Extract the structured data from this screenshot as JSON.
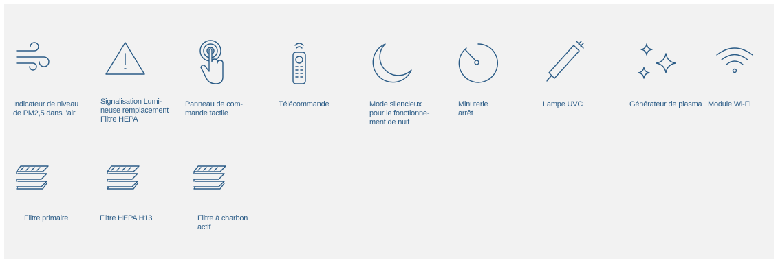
{
  "features": [
    {
      "icon": "wind-icon",
      "label": "Indicateur de niveau\nde PM2,5 dans l’air"
    },
    {
      "icon": "warning-triangle-icon",
      "label": "Signalisation Lumi-\nneuse remplacement\nFiltre  HEPA"
    },
    {
      "icon": "touch-hand-icon",
      "label": "Panneau de com-\nmande tactile"
    },
    {
      "icon": "remote-control-icon",
      "label": "Télécommande"
    },
    {
      "icon": "moon-icon",
      "label": "Mode silencieux\npour le fonctionne-\nment de nuit"
    },
    {
      "icon": "timer-icon",
      "label": "Minuterie\narrêt"
    },
    {
      "icon": "uvc-lamp-icon",
      "label": "Lampe UVC"
    },
    {
      "icon": "sparkles-icon",
      "label": "Générateur de plasma"
    },
    {
      "icon": "wifi-icon",
      "label": "Module Wi-Fi"
    },
    {
      "icon": "filter-layers-icon",
      "label": "Filtre primaire"
    },
    {
      "icon": "filter-layers-icon",
      "label": "Filtre HEPA H13"
    },
    {
      "icon": "filter-layers-icon",
      "label": "Filtre à charbon\nactif"
    }
  ],
  "colors": {
    "accent": "#2a5b86",
    "panel": "#f2f2f2"
  }
}
